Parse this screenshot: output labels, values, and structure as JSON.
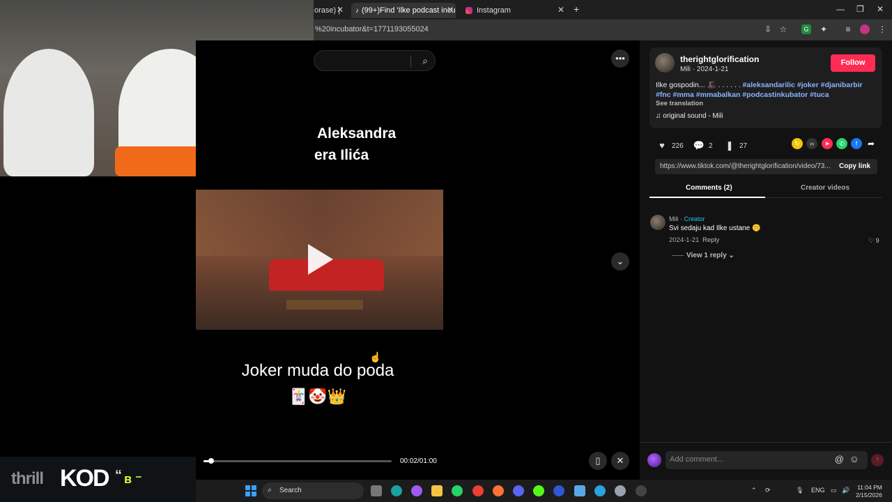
{
  "browser": {
    "tabs": [
      {
        "label": "orase) |"
      },
      {
        "label": "(99+)Find 'Ilke podcast incuba..."
      },
      {
        "label": "Instagram"
      }
    ],
    "address": "%20incubator&t=1771193055024",
    "new_tab": "+"
  },
  "video": {
    "overlay_line1": "Aleksandra",
    "overlay_line2": "era Ilića",
    "caption": "Joker muda do poda",
    "caption_emojis": "🃏🤡👑",
    "time": "00:02/01:00",
    "progress": 0.04
  },
  "post": {
    "username": "therightglorification",
    "meta": "Mili · 2024-1-21",
    "follow_label": "Follow",
    "description_text": "Ilke gospodin... 🎩 . . . . . . ",
    "hashtags_line1": "#aleksandarilic #joker #djanibarbir",
    "hashtags_line2": "#fnc #mma #mmabalkan #podcastinkubator #tuca",
    "see_translation": "See translation",
    "sound": "original sound - Mili",
    "likes": "226",
    "comments": "2",
    "saves": "27",
    "link": "https://www.tiktok.com/@therightglorification/video/73...",
    "copy_link": "Copy link"
  },
  "tabs": {
    "comments": "Comments (2)",
    "creator_videos": "Creator videos"
  },
  "comment": {
    "author": "Mili",
    "author_sep": " · ",
    "creator_badge": "Creator",
    "text": "Svi sedaju kad Ilke ustane 🤫",
    "date": "2024-1-21",
    "reply": "Reply",
    "likes": "9",
    "view_replies": "View 1 reply"
  },
  "comment_input": {
    "placeholder": "Add comment..."
  },
  "logo": {
    "thrill": "thrill",
    "kod": "KOD",
    "quote": "“",
    "b": "ʙ ⁻"
  },
  "taskbar": {
    "search_label": "Search",
    "lang": "ENG",
    "time": "11:04 PM",
    "date": "2/15/2026"
  },
  "colors": {
    "accent": "#fe2c55",
    "hashtag": "#8ab4ff",
    "creator": "#25c2e6"
  }
}
